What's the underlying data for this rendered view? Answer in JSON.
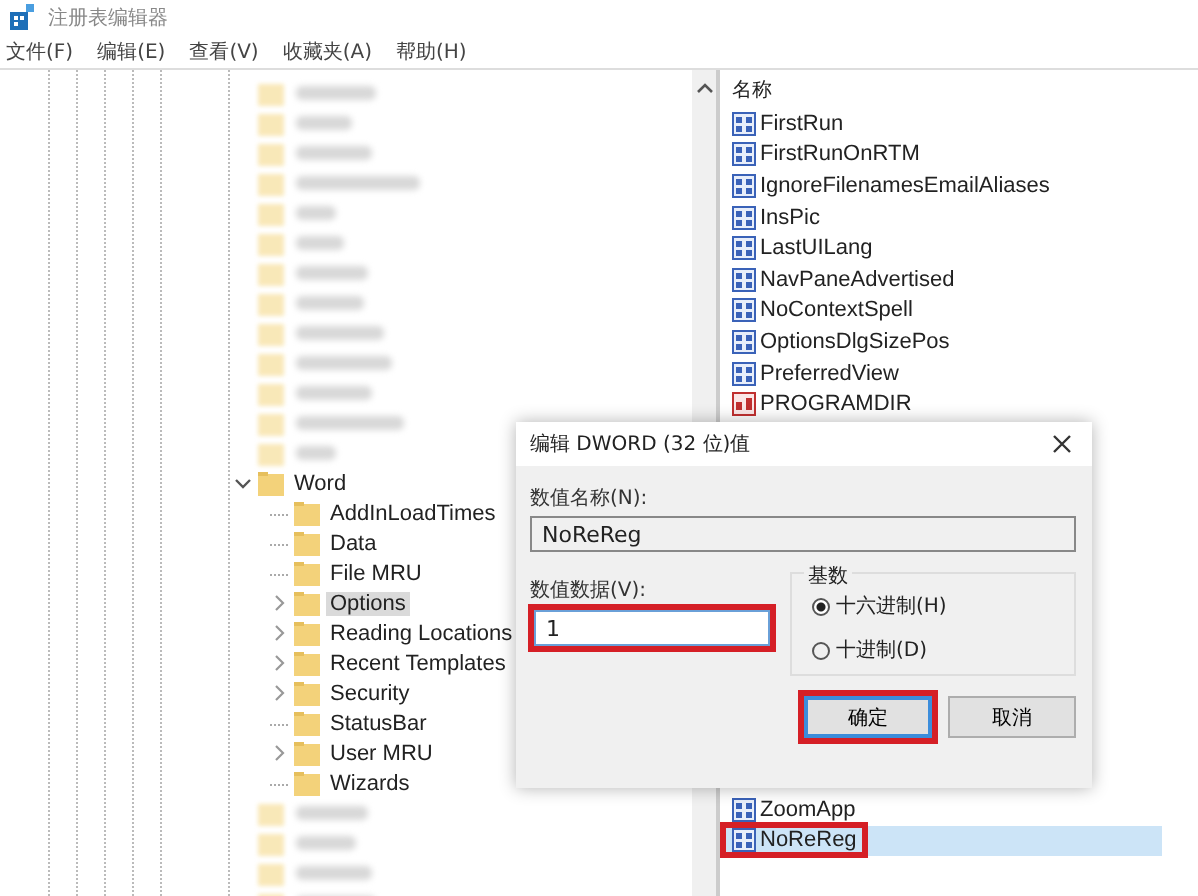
{
  "window": {
    "title": "注册表编辑器"
  },
  "menu": [
    "文件(F)",
    "编辑(E)",
    "查看(V)",
    "收藏夹(A)",
    "帮助(H)"
  ],
  "tree": {
    "items": [
      {
        "kind": "blurred"
      },
      {
        "kind": "blurred"
      },
      {
        "kind": "blurred"
      },
      {
        "kind": "blurred"
      },
      {
        "kind": "blurred"
      },
      {
        "kind": "blurred"
      },
      {
        "kind": "blurred"
      },
      {
        "kind": "blurred"
      },
      {
        "kind": "blurred"
      },
      {
        "kind": "blurred"
      },
      {
        "kind": "blurred"
      },
      {
        "kind": "blurred"
      },
      {
        "kind": "blurred"
      },
      {
        "kind": "key",
        "label": "Word",
        "expanded": true,
        "children": [
          {
            "label": "AddInLoadTimes",
            "has_children": false,
            "selected": false
          },
          {
            "label": "Data",
            "has_children": false,
            "selected": false
          },
          {
            "label": "File MRU",
            "has_children": false,
            "selected": false
          },
          {
            "label": "Options",
            "has_children": true,
            "selected": true
          },
          {
            "label": "Reading Locations",
            "has_children": true,
            "selected": false
          },
          {
            "label": "Recent Templates",
            "has_children": true,
            "selected": false
          },
          {
            "label": "Security",
            "has_children": true,
            "selected": false
          },
          {
            "label": "StatusBar",
            "has_children": false,
            "selected": false
          },
          {
            "label": "User MRU",
            "has_children": true,
            "selected": false
          },
          {
            "label": "Wizards",
            "has_children": false,
            "selected": false
          }
        ]
      },
      {
        "kind": "blurred"
      },
      {
        "kind": "blurred"
      },
      {
        "kind": "blurred"
      },
      {
        "kind": "blurred"
      }
    ]
  },
  "values": {
    "header": "名称",
    "rows": [
      {
        "kind": "dword",
        "name": "FirstRun",
        "selected": false,
        "highlighted": false
      },
      {
        "kind": "dword",
        "name": "FirstRunOnRTM",
        "selected": false,
        "highlighted": false
      },
      {
        "kind": "dword",
        "name": "IgnoreFilenamesEmailAliases",
        "selected": false,
        "highlighted": false
      },
      {
        "kind": "dword",
        "name": "InsPic",
        "selected": false,
        "highlighted": false
      },
      {
        "kind": "dword",
        "name": "LastUILang",
        "selected": false,
        "highlighted": false
      },
      {
        "kind": "dword",
        "name": "NavPaneAdvertised",
        "selected": false,
        "highlighted": false
      },
      {
        "kind": "dword",
        "name": "NoContextSpell",
        "selected": false,
        "highlighted": false
      },
      {
        "kind": "dword",
        "name": "OptionsDlgSizePos",
        "selected": false,
        "highlighted": false
      },
      {
        "kind": "dword",
        "name": "PreferredView",
        "selected": false,
        "highlighted": false
      },
      {
        "kind": "string",
        "name": "PROGRAMDIR",
        "selected": false,
        "highlighted": false
      },
      {
        "kind": "hidden"
      },
      {
        "kind": "hidden"
      },
      {
        "kind": "hidden"
      },
      {
        "kind": "hidden"
      },
      {
        "kind": "hidden"
      },
      {
        "kind": "hidden"
      },
      {
        "kind": "hidden"
      },
      {
        "kind": "hidden"
      },
      {
        "kind": "hidden"
      },
      {
        "kind": "hidden"
      },
      {
        "kind": "hidden"
      },
      {
        "kind": "hidden"
      },
      {
        "kind": "dword",
        "name": "ZoomApp",
        "selected": false,
        "highlighted": false
      },
      {
        "kind": "dword",
        "name": "NoReReg",
        "selected": true,
        "highlighted": true
      }
    ]
  },
  "dialog": {
    "title": "编辑 DWORD (32 位)值",
    "name_label": "数值名称(N):",
    "name_value": "NoReReg",
    "data_label": "数值数据(V):",
    "data_value": "1",
    "data_highlighted": true,
    "base_label": "基数",
    "bases": [
      {
        "label": "十六进制(H)",
        "selected": true
      },
      {
        "label": "十进制(D)",
        "selected": false
      }
    ],
    "buttons": [
      {
        "label": "确定",
        "kind": "default",
        "highlighted": true
      },
      {
        "label": "取消",
        "kind": "normal",
        "highlighted": false
      }
    ]
  }
}
